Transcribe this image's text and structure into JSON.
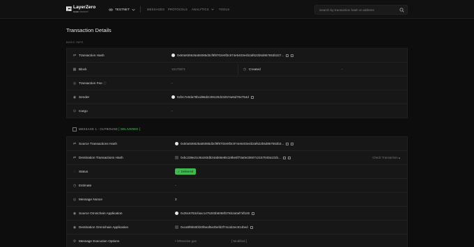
{
  "nav": {
    "logo_title": "LayerZero",
    "logo_sub": "scan",
    "logo_sub_tag": "testnet",
    "network": "TESTNET",
    "links": [
      "MESSAGES",
      "PROTOCOLS",
      "ANALYTICS",
      "TOOLS"
    ],
    "search_placeholder": "Search by transaction hash or address"
  },
  "page_title": "Transaction Details",
  "basic_info": {
    "section_label": "BASIC INFO",
    "rows": {
      "tx_hash": {
        "label": "Transaction Hash",
        "value": "0x50a936626a55085d3cf9f8702e8f3c974e5403e4b2af622b5d867653b327..."
      },
      "block": {
        "label": "Block",
        "value": "15170871",
        "created_label": "Created",
        "created_value": "-"
      },
      "fee": {
        "label": "Transaction Fee",
        "value": "-"
      },
      "sender": {
        "label": "Sender",
        "value": "0xf2c7e0da78bcd86d2c08120d23257ae5d70e754d"
      },
      "cargo": {
        "label": "Cargo",
        "value": "-"
      }
    }
  },
  "message": {
    "header": "MESSAGE 1 - OUTBOUND",
    "status_tag": "[ DELIVERED ]",
    "rows": {
      "src_hash": {
        "label": "Source Transactions Hash",
        "value": "0x50a936626a55085d3cf9f8702e8f3c974e5403e4b2af622b5d867653b3..."
      },
      "dst_hash": {
        "label": "Destination Transactions Hash",
        "value": "0xbc238e21c9a183db24ab66e85119be5f73a0e33607c2157040a131b...",
        "action": "Check Transaction"
      },
      "status": {
        "label": "Status",
        "value": "Delivered"
      },
      "estimate": {
        "label": "Estimate",
        "value": "-"
      },
      "nonce": {
        "label": "Message Nonce",
        "value": "3"
      },
      "src_app": {
        "label": "Source Omnichain Application",
        "value": "0x39c6783cfaac1475283b6058f376b2a0af7df100"
      },
      "dst_app": {
        "label": "Destination Omnichain Application",
        "value": "0xca9f9b50bf20f6eaf5e2befd2f74cab2ec914bed"
      },
      "exec_options": {
        "label": "Message Execution Options",
        "value": "• lzReceive gas",
        "value2": "[ Modified ]"
      }
    }
  },
  "colors": {
    "status_green": "#3fb950",
    "bg": "#0d0d0d",
    "card": "#171717"
  }
}
